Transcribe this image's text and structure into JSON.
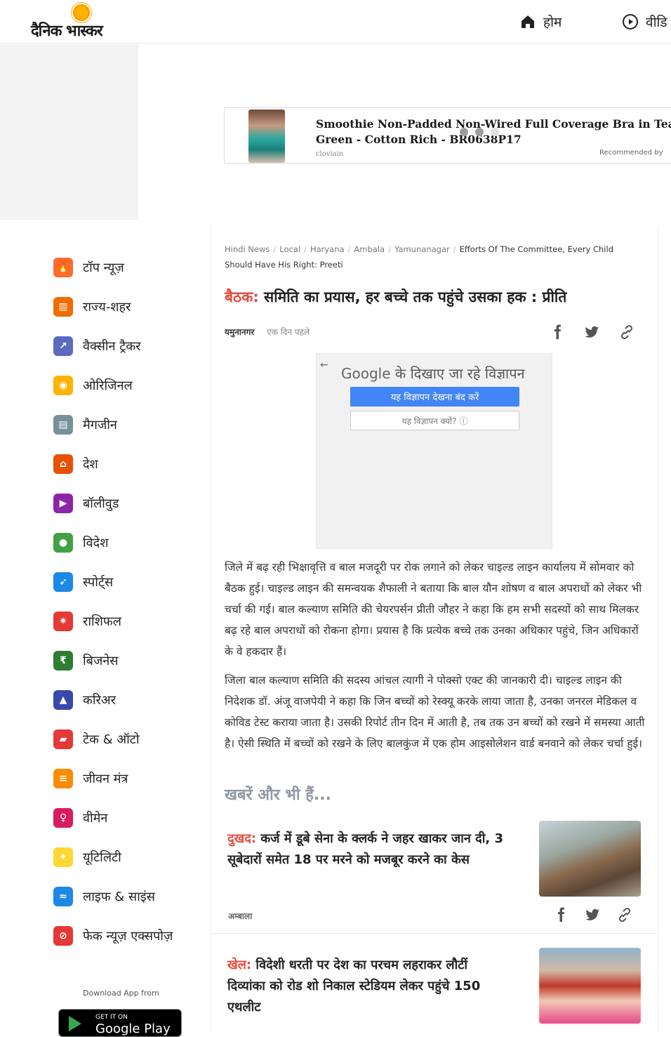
{
  "header": {
    "logo_text": "दैनिक भास्कर",
    "nav_home": "होम",
    "nav_video": "वीडि"
  },
  "ad": {
    "title": "Smoothie Non-Padded Non-Wired Full Coverage Bra in Teal Green - Cotton Rich - BR0638P17",
    "source": "cloviain",
    "recommended": "Recommended by"
  },
  "sidebar": {
    "items": [
      {
        "label": "टॉप न्यूज़",
        "icon": "fire-icon",
        "color": "#ff6b2c"
      },
      {
        "label": "राज्य-शहर",
        "icon": "city-icon",
        "color": "#ef6c00"
      },
      {
        "label": "वैक्सीन ट्रैकर",
        "icon": "syringe-icon",
        "color": "#5c6bc0"
      },
      {
        "label": "ओरिजिनल",
        "icon": "lamp-icon",
        "color": "#ffb300"
      },
      {
        "label": "मैगजीन",
        "icon": "magazine-icon",
        "color": "#78909c"
      },
      {
        "label": "देश",
        "icon": "india-gate-icon",
        "color": "#e65100"
      },
      {
        "label": "बॉलीवुड",
        "icon": "clapper-icon",
        "color": "#8e24aa"
      },
      {
        "label": "विदेश",
        "icon": "globe-icon",
        "color": "#43a047"
      },
      {
        "label": "स्पोर्ट्स",
        "icon": "runner-icon",
        "color": "#1e88e5"
      },
      {
        "label": "राशिफल",
        "icon": "zodiac-icon",
        "color": "#e53935"
      },
      {
        "label": "बिजनेस",
        "icon": "rupee-icon",
        "color": "#2e7d32"
      },
      {
        "label": "करिअर",
        "icon": "graduation-cap-icon",
        "color": "#3949ab"
      },
      {
        "label": "टेक & ऑटो",
        "icon": "car-icon",
        "color": "#e53935"
      },
      {
        "label": "जीवन मंत्र",
        "icon": "book-icon",
        "color": "#fb8c00"
      },
      {
        "label": "वीमेन",
        "icon": "women-icon",
        "color": "#d81b60"
      },
      {
        "label": "यूटिलिटी",
        "icon": "bulb-icon",
        "color": "#fdd835"
      },
      {
        "label": "लाइफ & साइंस",
        "icon": "dna-icon",
        "color": "#1e88e5"
      },
      {
        "label": "फेक न्यूज़ एक्सपोज़",
        "icon": "fake-icon",
        "color": "#e53935"
      }
    ],
    "download_label": "Download App from",
    "gplay_line1": "GET IT ON",
    "gplay_line2": "Google Play"
  },
  "breadcrumb": {
    "items": [
      "Hindi News",
      "Local",
      "Haryana",
      "Ambala",
      "Yamunanagar"
    ],
    "current": "Efforts Of The Committee, Every Child Should Have His Right: Preeti"
  },
  "article": {
    "kicker": "बैठक:",
    "title": " समिति का प्रयास, हर बच्चे तक पहुंचे उसका हक : प्रीति",
    "place": "यमुनानगर",
    "time": "एक दिन पहले",
    "paragraphs": [
      "जिले में बढ़ रही भिक्षावृत्ति व बाल मजदूरी पर रोक लगाने को लेकर चाइल्ड लाइन कार्यालय में सोमवार को बैठक हुई। चाइल्ड लाइन की समन्वयक शैफाली ने बताया कि बाल यौन शोषण व बाल अपराधों को लेकर भी चर्चा की गई। बाल कल्याण समिति की चेयरपर्सन प्रीती जौहर ने कहा कि हम सभी सदस्यों को साथ मिलकर बढ़ रहे बाल अपराधों को रोकना होगा। प्रयास है कि प्रत्येक बच्चे तक उनका अधिकार पहुंचे, जिन अधिकारों के वे हकदार हैं।",
      "जिला बाल कल्याण समिति की सदस्य आंचल त्यागी ने पोक्सो एक्ट की जानकारी दी। चाइल्ड लाइन की निदेशक डॉ. अंजू वाजपेयी ने कहा कि जिन बच्चों को रेस्क्यू करके लाया जाता है, उनका जनरल मेडिकल व कोविड टेस्ट कराया जाता है। उसकी रिपोर्ट तीन दिन में आती है, तब तक उन बच्चों को रखने में समस्या आती है। ऐसी स्थिति में बच्चों को रखने के लिए बालकुंज में एक होम आइसोलेशन वार्ड बनवाने को लेकर चर्चा हुई।"
    ]
  },
  "google_ad": {
    "brand": "Google",
    "title_rest": " के दिखाए जा रहे विज्ञापन",
    "stop_label": "यह विज्ञापन देखना बंद करें",
    "why_label": "यह विज्ञापन क्यों? ⓘ"
  },
  "more": {
    "heading": "खबरें और भी हैं...",
    "cards": [
      {
        "kicker": "दुखद:",
        "title": " कर्ज में डूबे सेना के क्लर्क ने जहर खाकर जान दी, 3 सूबेदारों समेत 18 पर मरने को मजबूर करने का केस",
        "place": "अम्बाला"
      },
      {
        "kicker": "खेल:",
        "title": " विदेशी धरती पर देश का परचम लहराकर लौटीं दिव्यांका को रोड शो निकाल स्टेडियम लेकर पहुंचे 150 एथलीट",
        "place": ""
      }
    ]
  }
}
